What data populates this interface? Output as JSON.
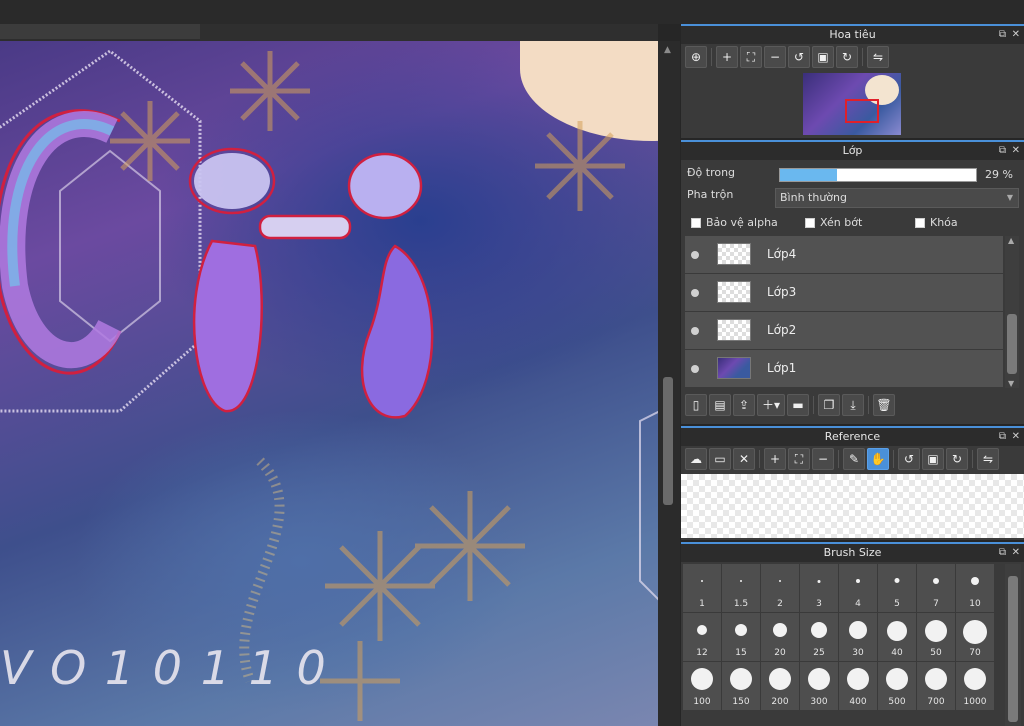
{
  "canvas": {
    "text_bottom": "V O 1 0 1 1 0"
  },
  "navigator": {
    "title": "Hoa tiêu",
    "tools": [
      "zoom-fit-icon",
      "zoom-in-icon",
      "fit-screen-icon",
      "zoom-out-icon",
      "rotate-left-icon",
      "actual-size-icon",
      "rotate-right-icon",
      "flip-icon"
    ]
  },
  "layer_panel": {
    "title": "Lớp",
    "opacity_label": "Độ trong",
    "opacity_value": "29 %",
    "opacity_fraction": 0.29,
    "blend_label": "Pha trộn",
    "blend_value": "Bình thường",
    "checks": {
      "protect_alpha": "Bảo vệ alpha",
      "clipping": "Xén bớt",
      "lock": "Khóa"
    },
    "layers": [
      {
        "name": "Lớp4",
        "thumb": "transparent"
      },
      {
        "name": "Lớp3",
        "thumb": "transparent"
      },
      {
        "name": "Lớp2",
        "thumb": "transparent"
      },
      {
        "name": "Lớp1",
        "thumb": "image"
      }
    ]
  },
  "reference": {
    "title": "Reference"
  },
  "brush_size": {
    "title": "Brush Size",
    "sizes": [
      "1",
      "1.5",
      "2",
      "3",
      "4",
      "5",
      "7",
      "10",
      "12",
      "15",
      "20",
      "25",
      "30",
      "40",
      "50",
      "70",
      "100",
      "150",
      "200",
      "300",
      "400",
      "500",
      "700",
      "1000"
    ]
  }
}
